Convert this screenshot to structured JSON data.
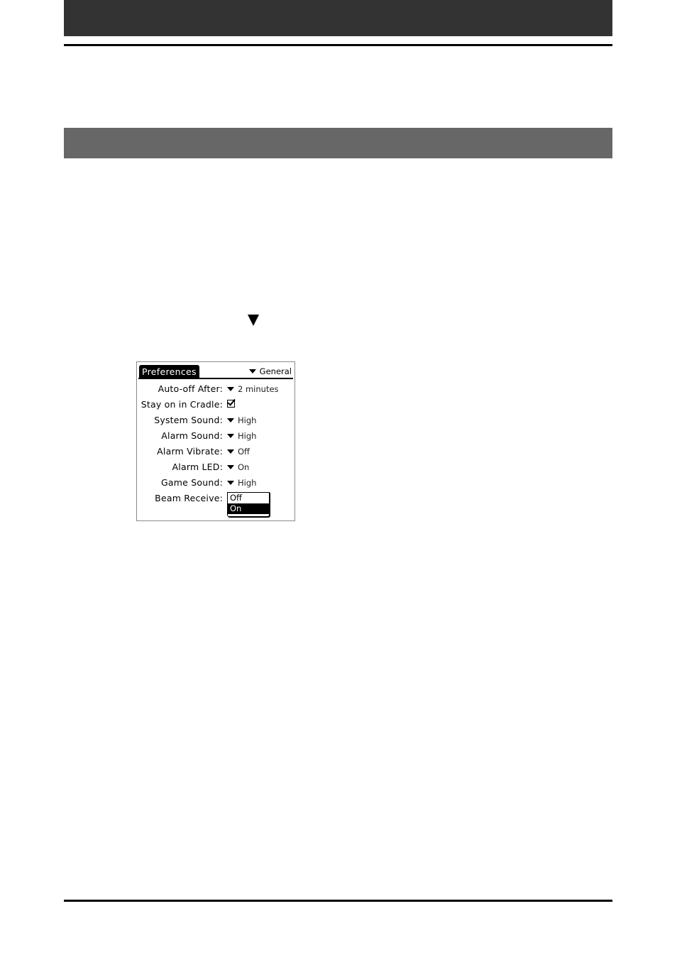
{
  "page": {
    "step_arrow_icon": "down-triangle-icon"
  },
  "screen": {
    "title": "Preferences",
    "category": {
      "icon": "dropdown-triangle-icon",
      "value": "General"
    },
    "rows": [
      {
        "label": "Auto-off After:",
        "type": "dropdown",
        "value": "2 minutes"
      },
      {
        "label": "Stay on in Cradle:",
        "type": "checkbox",
        "checked": true
      },
      {
        "label": "System Sound:",
        "type": "dropdown",
        "value": "High"
      },
      {
        "label": "Alarm Sound:",
        "type": "dropdown",
        "value": "High"
      },
      {
        "label": "Alarm Vibrate:",
        "type": "dropdown",
        "value": "Off"
      },
      {
        "label": "Alarm LED:",
        "type": "dropdown",
        "value": "On"
      },
      {
        "label": "Game Sound:",
        "type": "dropdown",
        "value": "High"
      },
      {
        "label": "Beam Receive:",
        "type": "popup-open"
      }
    ],
    "beam_popup": {
      "options": [
        "Off",
        "On"
      ],
      "selected": "On"
    }
  }
}
